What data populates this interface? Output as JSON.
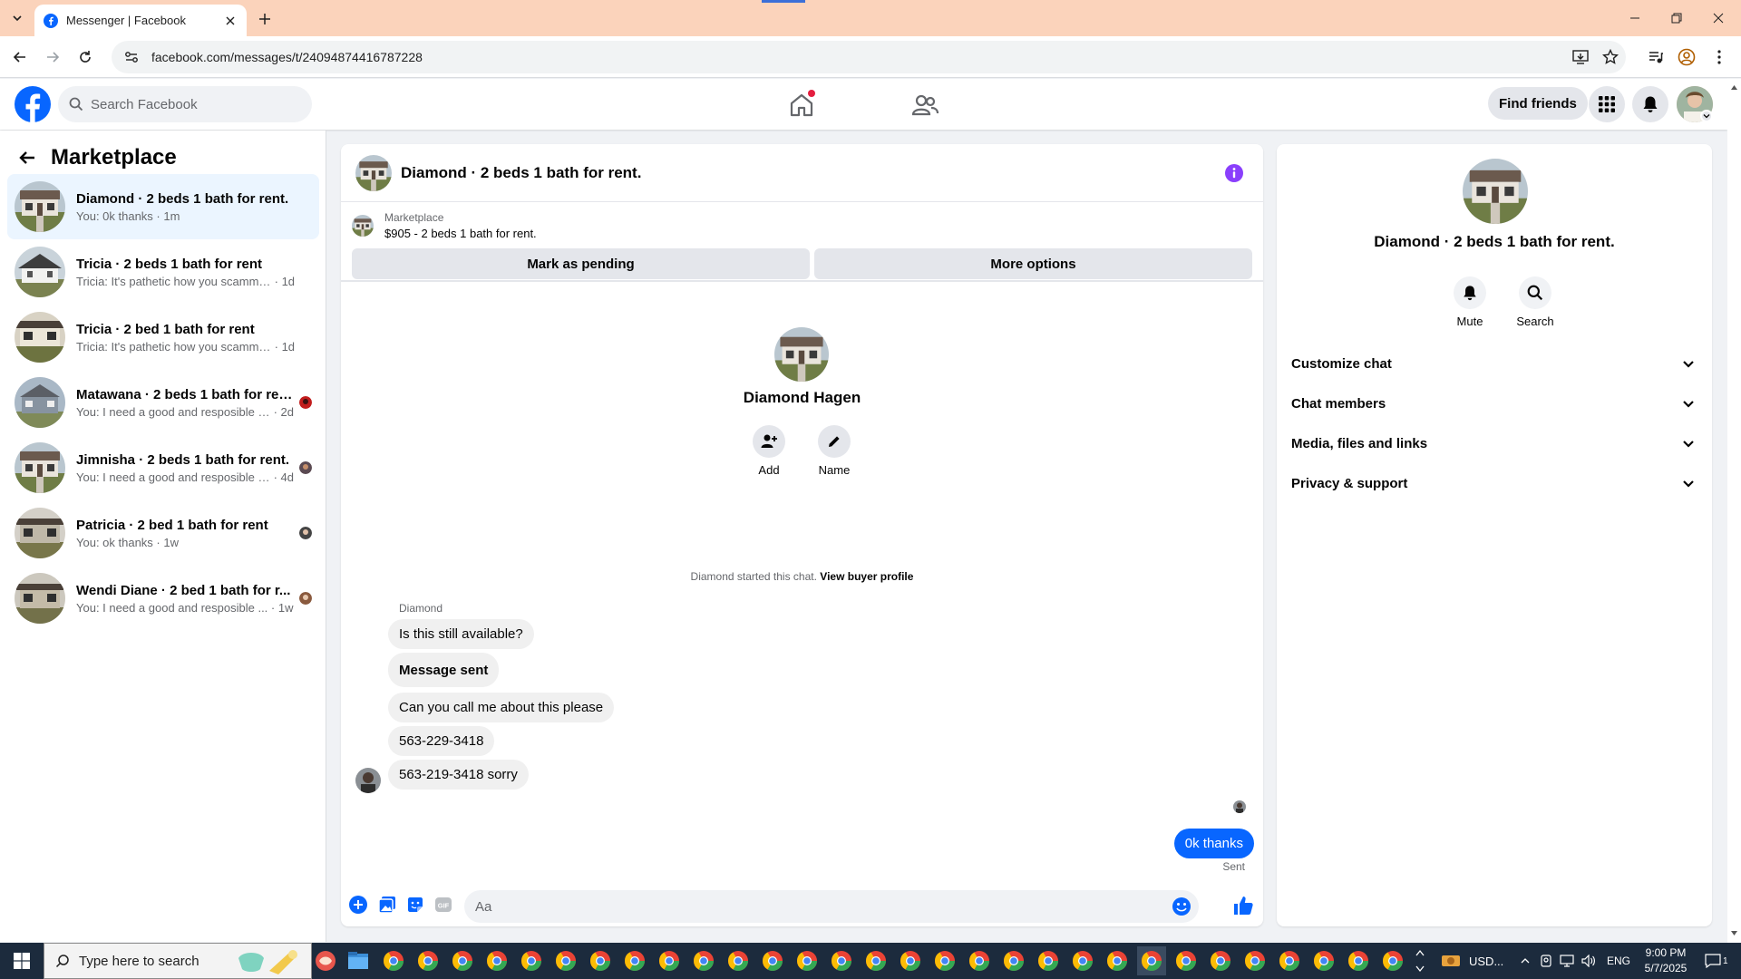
{
  "browser": {
    "tab_title": "Messenger | Facebook",
    "url": "facebook.com/messages/t/24094874416787228"
  },
  "fb": {
    "search_placeholder": "Search Facebook",
    "find_friends": "Find friends"
  },
  "left": {
    "title": "Marketplace",
    "conversations": [
      {
        "name": "Diamond · 2 beds 1 bath for rent.",
        "preview": "You: 0k thanks",
        "time": "1m"
      },
      {
        "name": "Tricia · 2 beds 1 bath for rent",
        "preview": "Tricia: It's pathetic how you scammers ...",
        "time": "1d"
      },
      {
        "name": "Tricia · 2 bed 1 bath for rent",
        "preview": "Tricia: It's pathetic how you scammers ...",
        "time": "1d"
      },
      {
        "name": "Matawana · 2 beds 1 bath for rent.",
        "preview": "You: I need a good and resposible t...",
        "time": "2d"
      },
      {
        "name": "Jimnisha · 2 beds 1 bath for rent.",
        "preview": "You: I need a good and resposible t...",
        "time": "4d"
      },
      {
        "name": "Patricia · 2 bed 1 bath for rent",
        "preview": "You: ok thanks",
        "time": "1w"
      },
      {
        "name": "Wendi Diane · 2 bed 1 bath for r...",
        "preview": "You: I need a good and resposible ...",
        "time": "1w"
      }
    ]
  },
  "chat": {
    "title": "Diamond · 2 beds 1 bath for rent.",
    "listing_label": "Marketplace",
    "listing_price": "$905 - 2 beds 1 bath for rent.",
    "mark_pending": "Mark as pending",
    "more_options": "More options",
    "profile_name": "Diamond Hagen",
    "add_label": "Add",
    "name_label": "Name",
    "started_text": "Diamond started this chat.",
    "view_profile": "View buyer profile",
    "sender": "Diamond",
    "messages": [
      "Is this still available?",
      "Message sent",
      "Can you call me about this please",
      "563-229-3418",
      "563-219-3418 sorry"
    ],
    "my_message": "0k thanks",
    "status": "Sent",
    "composer_placeholder": "Aa"
  },
  "right": {
    "title": "Diamond · 2 beds 1 bath for rent.",
    "mute": "Mute",
    "search": "Search",
    "sections": [
      "Customize chat",
      "Chat members",
      "Media, files and links",
      "Privacy & support"
    ]
  },
  "taskbar": {
    "search_placeholder": "Type here to search",
    "weather": "USD...",
    "lang": "ENG",
    "time": "9:00 PM",
    "date": "5/7/2025",
    "notif_count": "1"
  },
  "colors": {
    "fb_blue": "#0866ff",
    "tabbar": "#fbd3bb",
    "active_conv": "#ebf5ff",
    "info_purple": "#8a3ffc"
  }
}
